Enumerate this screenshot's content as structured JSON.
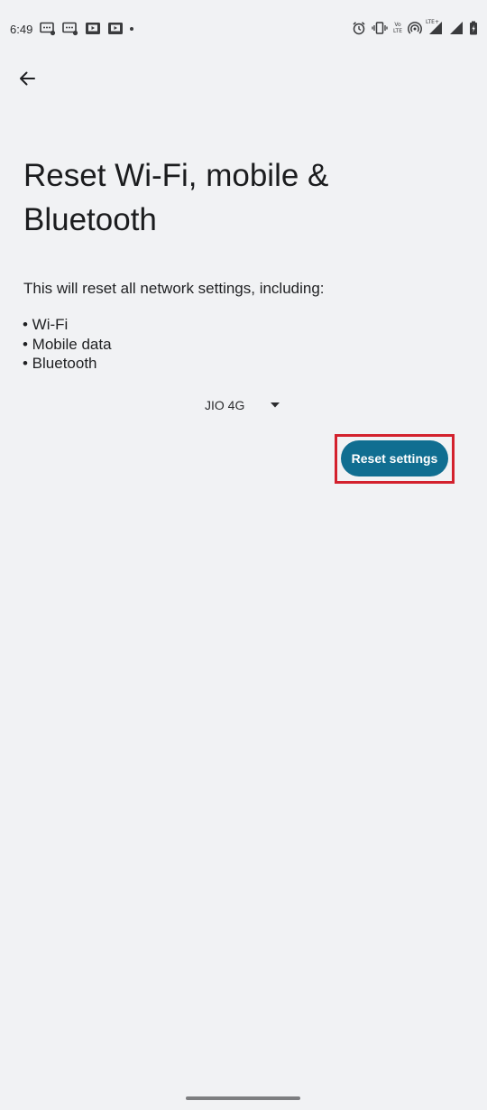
{
  "status_bar": {
    "time": "6:49",
    "volte_label_top": "Vo",
    "volte_label_bottom": "LTE",
    "lte_label": "LTE+",
    "notification_icons": [
      "message-icon",
      "message-icon",
      "video-app-icon",
      "video-app-icon"
    ],
    "system_icons": [
      "alarm-icon",
      "vibrate-icon",
      "volte-icon",
      "hotspot-icon",
      "signal-icon",
      "signal-icon",
      "battery-icon"
    ]
  },
  "page": {
    "title": "Reset Wi-Fi, mobile & Bluetooth",
    "description": "This will reset all network settings, including:",
    "items": [
      "• Wi-Fi",
      "• Mobile data",
      "• Bluetooth"
    ]
  },
  "sim_selector": {
    "selected": "JIO 4G"
  },
  "actions": {
    "reset_label": "Reset settings"
  },
  "colors": {
    "background": "#f1f2f4",
    "button": "#106e91",
    "highlight": "#d3212d"
  }
}
